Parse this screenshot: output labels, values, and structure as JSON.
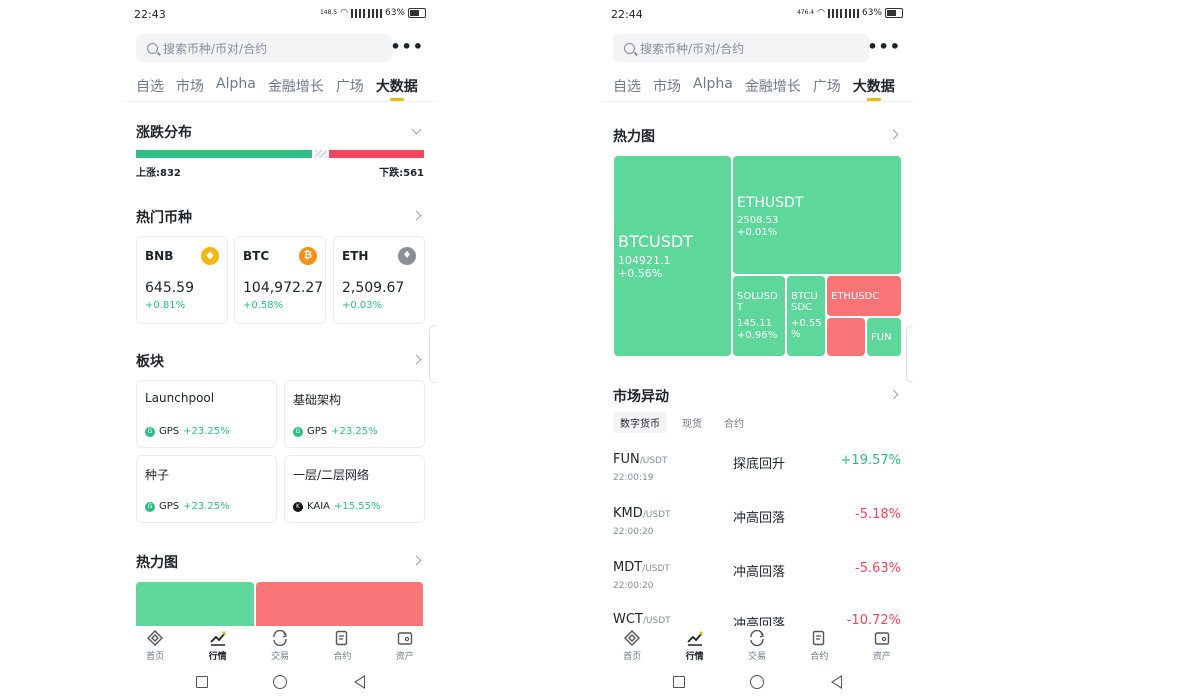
{
  "left": {
    "status": {
      "time": "22:43",
      "speed": "148.5",
      "battery": "63%"
    },
    "search": {
      "placeholder": "搜索币种/币对/合约"
    },
    "tabs": [
      "自选",
      "市场",
      "Alpha",
      "金融增长",
      "广场",
      "大数据"
    ],
    "active_tab": "大数据",
    "distribution": {
      "title": "涨跌分布",
      "up_label": "上涨:832",
      "down_label": "下跌:561",
      "up": 832,
      "down": 561
    },
    "hot_coins": {
      "title": "热门币种",
      "items": [
        {
          "symbol": "BNB",
          "price": "645.59",
          "change": "+0.81%",
          "icon": "bnb-icon",
          "color": "#f0b90b"
        },
        {
          "symbol": "BTC",
          "price": "104,972.27",
          "change": "+0.58%",
          "icon": "bitcoin-icon",
          "color": "#f7931a"
        },
        {
          "symbol": "ETH",
          "price": "2,509.67",
          "change": "+0.03%",
          "icon": "ethereum-icon",
          "color": "#8a8f99"
        }
      ]
    },
    "sectors": {
      "title": "板块",
      "items": [
        {
          "name": "Launchpool",
          "coin": "GPS",
          "change": "+23.25%"
        },
        {
          "name": "基础架构",
          "coin": "GPS",
          "change": "+23.25%"
        },
        {
          "name": "种子",
          "coin": "GPS",
          "change": "+23.25%"
        },
        {
          "name": "一层/二层网络",
          "coin": "KAIA",
          "change": "+15.55%"
        }
      ]
    },
    "heatmap_title": "热力图"
  },
  "right": {
    "status": {
      "time": "22:44",
      "speed": "476.4",
      "battery": "63%"
    },
    "search": {
      "placeholder": "搜索币种/币对/合约"
    },
    "tabs": [
      "自选",
      "市场",
      "Alpha",
      "金融增长",
      "广场",
      "大数据"
    ],
    "active_tab": "大数据",
    "heatmap": {
      "title": "热力图",
      "cells": [
        {
          "symbol": "BTCUSDT",
          "price": "104921.1",
          "change": "+0.56%",
          "color": "green"
        },
        {
          "symbol": "ETHUSDT",
          "price": "2508.53",
          "change": "+0.01%",
          "color": "green"
        },
        {
          "symbol": "SOLUSD T",
          "price": "145.11",
          "change": "+0.96%",
          "color": "green"
        },
        {
          "symbol": "BTCU SDC",
          "price": "",
          "change": "+0.55 %",
          "color": "green"
        },
        {
          "symbol": "ETHUSDC",
          "price": "",
          "change": "",
          "color": "red"
        },
        {
          "symbol": "",
          "price": "",
          "change": "",
          "color": "red"
        },
        {
          "symbol": "FUN",
          "price": "",
          "change": "",
          "color": "green"
        }
      ]
    },
    "movements": {
      "title": "市场异动",
      "tabs": [
        "数字货币",
        "现货",
        "合约"
      ],
      "rows": [
        {
          "base": "FUN",
          "quote": "/USDT",
          "time": "22:00:19",
          "type": "探底回升",
          "change": "+19.57%",
          "dir": "up"
        },
        {
          "base": "KMD",
          "quote": "/USDT",
          "time": "22:00:20",
          "type": "冲高回落",
          "change": "-5.18%",
          "dir": "down"
        },
        {
          "base": "MDT",
          "quote": "/USDT",
          "time": "22:00:20",
          "type": "冲高回落",
          "change": "-5.63%",
          "dir": "down"
        },
        {
          "base": "WCT",
          "quote": "/USDT",
          "time": "",
          "type": "冲高回落",
          "change": "-10.72%",
          "dir": "down"
        }
      ]
    }
  },
  "nav": {
    "items": [
      {
        "label": "首页",
        "icon": "home-icon"
      },
      {
        "label": "行情",
        "icon": "markets-icon"
      },
      {
        "label": "交易",
        "icon": "trade-icon"
      },
      {
        "label": "合约",
        "icon": "futures-icon"
      },
      {
        "label": "资产",
        "icon": "wallet-icon"
      }
    ],
    "active": "行情"
  },
  "colors": {
    "up": "#2ebd85",
    "down": "#f6465d",
    "accent": "#f0b90b",
    "heat_green": "#5ed79b",
    "heat_red": "#f87476"
  }
}
